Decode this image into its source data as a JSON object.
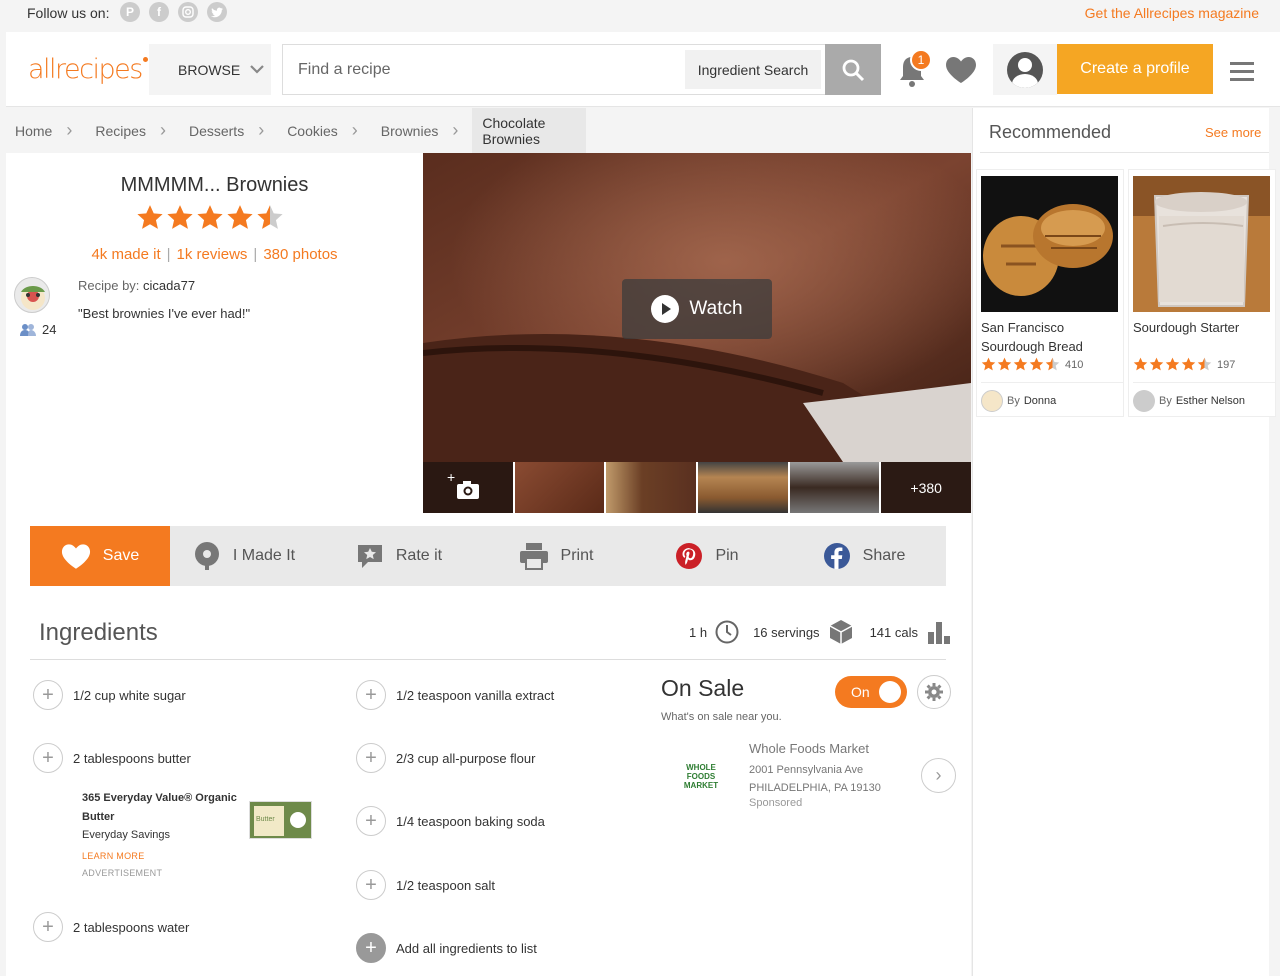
{
  "topbar": {
    "follow_label": "Follow us on:",
    "social_icons": [
      "pinterest-icon",
      "facebook-icon",
      "instagram-icon",
      "twitter-icon"
    ],
    "magazine_link": "Get the Allrecipes magazine"
  },
  "header": {
    "logo_text": "allrecipes",
    "browse_label": "BROWSE",
    "search_placeholder": "Find a recipe",
    "ingredient_search_label": "Ingredient Search",
    "notification_count": "1",
    "create_profile_label": "Create a profile"
  },
  "breadcrumb": [
    "Home",
    "Recipes",
    "Desserts",
    "Cookies",
    "Brownies",
    "Chocolate Brownies"
  ],
  "recipe": {
    "title": "MMMMM... Brownies",
    "rating": 4.5,
    "made_it": "4k made it",
    "reviews": "1k reviews",
    "photos": "380 photos",
    "recipe_by_label": "Recipe by:",
    "author": "cicada77",
    "followers": "24",
    "quote": "\"Best brownies I've ever had!\"",
    "watch_label": "Watch",
    "more_photos": "+380"
  },
  "actions": {
    "save": "Save",
    "made_it": "I Made It",
    "rate": "Rate it",
    "print": "Print",
    "pin": "Pin",
    "share": "Share"
  },
  "ingredients": {
    "title": "Ingredients",
    "time": "1 h",
    "servings": "16 servings",
    "calories": "141 cals",
    "col1": [
      "1/2 cup white sugar",
      "2 tablespoons butter",
      "2 tablespoons water"
    ],
    "col2": [
      "1/2 teaspoon vanilla extract",
      "2/3 cup all-purpose flour",
      "1/4 teaspoon baking soda",
      "1/2 teaspoon salt"
    ],
    "add_all": "Add all ingredients to list"
  },
  "ad": {
    "product_name": "365 Everyday Value® Organic Butter",
    "sub": "Everyday Savings",
    "learn_more": "LEARN MORE",
    "advertisement": "ADVERTISEMENT",
    "image_label": "Butter"
  },
  "on_sale": {
    "title": "On Sale",
    "subtitle": "What's on sale near you.",
    "toggle_label": "On",
    "store_logo_text": "WHOLE FOODS MARKET",
    "store_name": "Whole Foods Market",
    "address_line1": "2001 Pennsylvania Ave",
    "address_line2": "PHILADELPHIA, PA 19130",
    "sponsored": "Sponsored"
  },
  "sidebar": {
    "title": "Recommended",
    "see_more": "See more",
    "cards": [
      {
        "name": "San Francisco Sourdough Bread",
        "rating": 4.5,
        "count": "410",
        "by": "By",
        "author": "Donna"
      },
      {
        "name": "Sourdough Starter",
        "rating": 4.5,
        "count": "197",
        "by": "By",
        "author": "Esther Nelson"
      }
    ]
  },
  "colors": {
    "brand": "#f47a20",
    "accent_yellow": "#f5a623",
    "pinterest": "#cb2027",
    "facebook": "#3b5998"
  }
}
